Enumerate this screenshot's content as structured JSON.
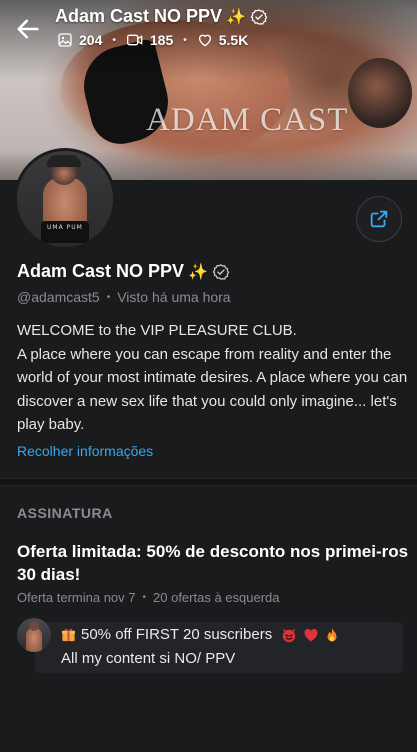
{
  "header": {
    "title": "Adam Cast NO PPV",
    "stats": {
      "photos": "204",
      "videos": "185",
      "likes": "5.5K"
    }
  },
  "cover": {
    "watermark": "ADAM CAST"
  },
  "profile": {
    "name": "Adam Cast NO PPV",
    "handle": "@adamcast5",
    "last_seen": "Visto  há uma hora",
    "bio": [
      "WELCOME to the VIP PLEASURE CLUB.",
      "A place where you can escape from reality and enter the world of your most intimate desires. A place where you can discover a new sex life that you could only imagine... let's play baby."
    ],
    "collapse_label": "Recolher informações",
    "avatar_print": "UMA PUM"
  },
  "subscription": {
    "heading": "ASSINATURA",
    "offer_title": "Oferta limitada: 50% de desconto nos primei-ros 30 dias!",
    "offer_end": "Oferta termina nov 7",
    "offers_left": "20 ofertas à esquerda",
    "promo": {
      "line1": "50% off FIRST 20 suscribers",
      "line2": "All my content si NO/ PPV"
    }
  },
  "colors": {
    "background": "#1a1b1d",
    "link": "#3aa8ea",
    "muted": "#8a8b8f"
  },
  "icons": [
    "back-arrow-icon",
    "sparkles-icon",
    "verified-badge-icon",
    "image-icon",
    "video-icon",
    "heart-icon",
    "share-icon",
    "gift-icon",
    "devil-icon",
    "fire-icon"
  ]
}
